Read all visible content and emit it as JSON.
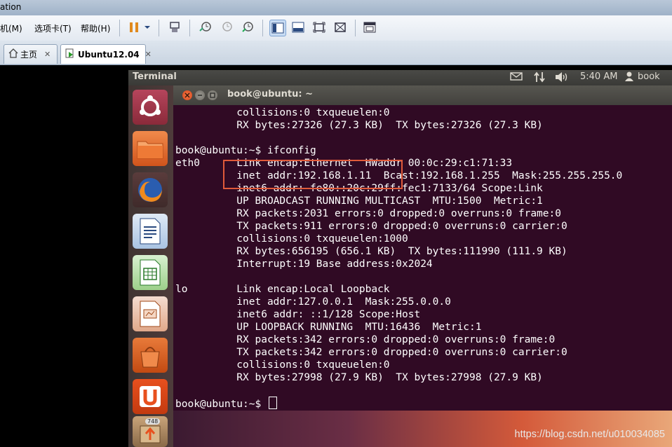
{
  "window": {
    "title_fragment": "ation"
  },
  "menu": {
    "items": [
      {
        "label": "机(M)"
      },
      {
        "label": "选项卡(T)"
      },
      {
        "label": "帮助(H)"
      }
    ]
  },
  "tabs": [
    {
      "label": "主页",
      "close": "✕"
    },
    {
      "label": "Ubuntu12.04",
      "close": "✕"
    }
  ],
  "ubuntu_panel": {
    "app_title": "Terminal",
    "time": "5:40 AM",
    "user": "book"
  },
  "launcher": {
    "update_badge": "748"
  },
  "terminal": {
    "window_title": "book@ubuntu: ~",
    "lines": [
      "          collisions:0 txqueuelen:0",
      "          RX bytes:27326 (27.3 KB)  TX bytes:27326 (27.3 KB)",
      "",
      "book@ubuntu:~$ ifconfig",
      "eth0      Link encap:Ethernet  HWaddr 00:0c:29:c1:71:33",
      "          inet addr:192.168.1.11  Bcast:192.168.1.255  Mask:255.255.255.0",
      "          inet6 addr: fe80::20c:29ff:fec1:7133/64 Scope:Link",
      "          UP BROADCAST RUNNING MULTICAST  MTU:1500  Metric:1",
      "          RX packets:2031 errors:0 dropped:0 overruns:0 frame:0",
      "          TX packets:911 errors:0 dropped:0 overruns:0 carrier:0",
      "          collisions:0 txqueuelen:1000",
      "          RX bytes:656195 (656.1 KB)  TX bytes:111990 (111.9 KB)",
      "          Interrupt:19 Base address:0x2024",
      "",
      "lo        Link encap:Local Loopback",
      "          inet addr:127.0.0.1  Mask:255.0.0.0",
      "          inet6 addr: ::1/128 Scope:Host",
      "          UP LOOPBACK RUNNING  MTU:16436  Metric:1",
      "          RX packets:342 errors:0 dropped:0 overruns:0 frame:0",
      "          TX packets:342 errors:0 dropped:0 overruns:0 carrier:0",
      "          collisions:0 txqueuelen:0",
      "          RX bytes:27998 (27.9 KB)  TX bytes:27998 (27.9 KB)",
      "",
      "book@ubuntu:~$ "
    ]
  },
  "watermark": "https://blog.csdn.net/u010034085",
  "colors": {
    "terminal_bg": "#300a24",
    "highlight_box": "#e05a3a",
    "panel_bg": "#3c3b37"
  }
}
